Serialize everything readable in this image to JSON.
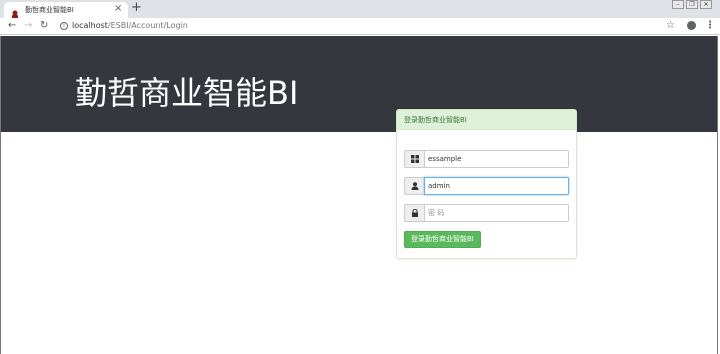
{
  "browser": {
    "tab_title": "勤哲商业智能BI",
    "tab_close": "×",
    "new_tab": "+",
    "url_host": "localhost",
    "url_path": "/ESBI/Account/Login",
    "window_controls": [
      "–",
      "❐",
      "✕"
    ]
  },
  "header": {
    "title": "勤哲商业智能BI"
  },
  "login_panel": {
    "heading": "登录勤哲商业智能BI",
    "account_value": "essample",
    "username_value": "admin",
    "password_placeholder": "密 码",
    "submit_label": "登录勤哲商业智能BI"
  },
  "colors": {
    "header_bg": "#34373d",
    "panel_heading_bg": "#dff0d8",
    "button_bg": "#5cb85c"
  },
  "icons": {
    "account_field": "grid-icon",
    "username_field": "user-icon",
    "password_field": "lock-icon"
  }
}
